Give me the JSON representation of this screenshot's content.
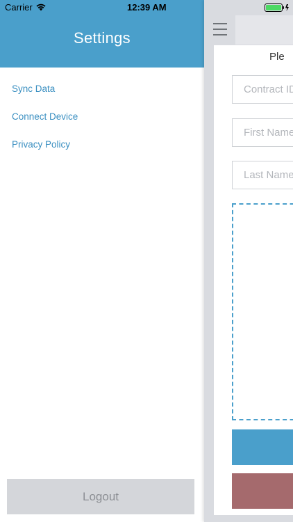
{
  "status_bar": {
    "carrier": "Carrier",
    "time": "12:39 AM",
    "wifi_icon": "wifi-icon",
    "battery_icon": "battery-icon",
    "battery_color": "#4cd964"
  },
  "drawer": {
    "title": "Settings",
    "header_color": "#4a9fcb",
    "items": [
      {
        "label": "Sync Data"
      },
      {
        "label": "Connect Device"
      },
      {
        "label": "Privacy Policy"
      }
    ],
    "logout_label": "Logout"
  },
  "main": {
    "menu_icon": "hamburger-icon",
    "heading_partial": "Ple",
    "fields": [
      {
        "placeholder": "Contract ID"
      },
      {
        "placeholder": "First Name"
      },
      {
        "placeholder": "Last Name"
      }
    ],
    "primary_color": "#4a9fcb",
    "secondary_color": "#a56a6d"
  }
}
